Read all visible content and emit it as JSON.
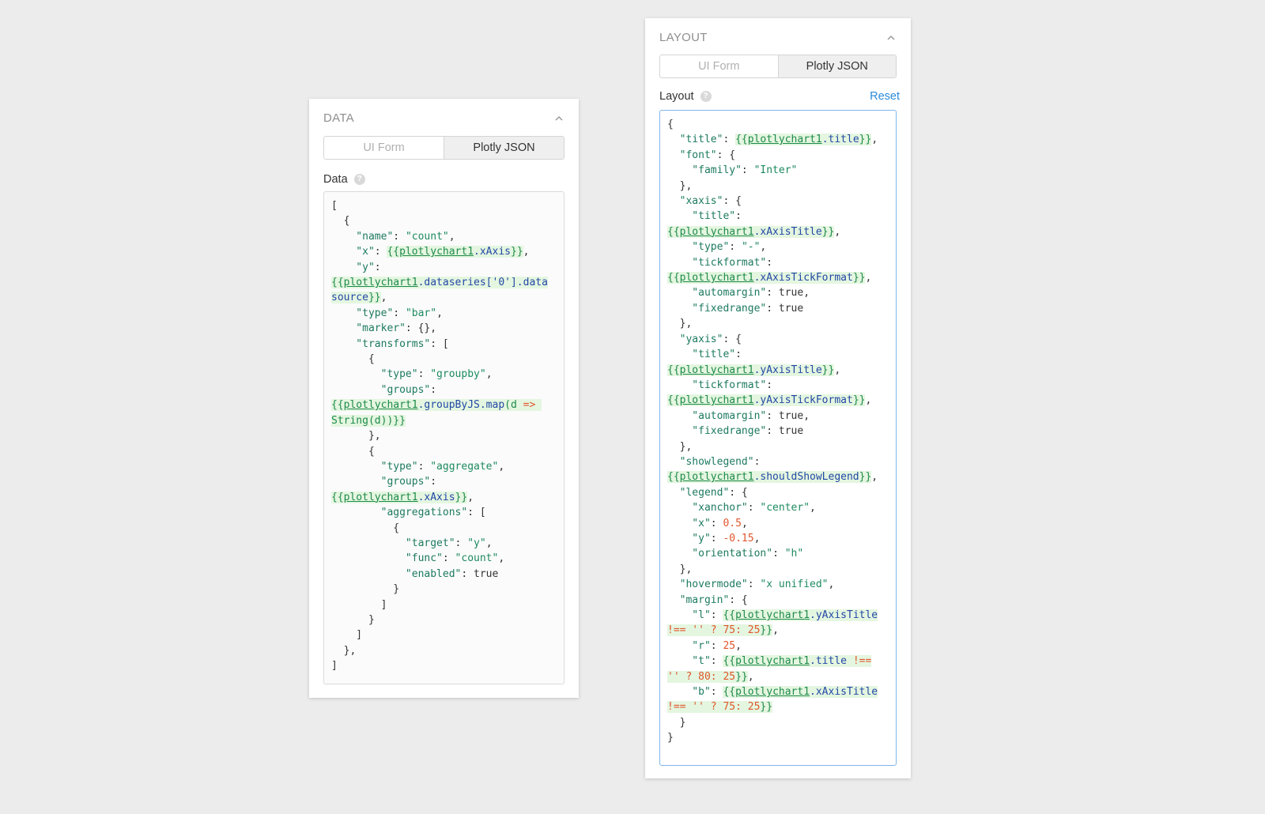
{
  "data_panel": {
    "title": "DATA",
    "tabs": [
      "UI Form",
      "Plotly JSON"
    ],
    "active_tab": "Plotly JSON",
    "field_label": "Data",
    "code_lines": [
      [
        [
          "p",
          "["
        ]
      ],
      [
        [
          "p",
          "  {"
        ]
      ],
      [
        [
          "k",
          "    \"name\""
        ],
        [
          "p",
          ": "
        ],
        [
          "s",
          "\"count\""
        ],
        [
          "p",
          ","
        ]
      ],
      [
        [
          "k",
          "    \"x\""
        ],
        [
          "p",
          ": "
        ],
        [
          "b",
          "{{"
        ],
        [
          "bu",
          "plotlychart1"
        ],
        [
          "bf",
          ".xAxis"
        ],
        [
          "b",
          "}}"
        ],
        [
          "p",
          ","
        ]
      ],
      [
        [
          "k",
          "    \"y\""
        ],
        [
          "p",
          ":"
        ]
      ],
      [
        [
          "b",
          "{{"
        ],
        [
          "bu",
          "plotlychart1"
        ],
        [
          "bf",
          ".dataseries['0'].data"
        ]
      ],
      [
        [
          "bf",
          "source"
        ],
        [
          "b",
          "}}"
        ],
        [
          "p",
          ","
        ]
      ],
      [
        [
          "k",
          "    \"type\""
        ],
        [
          "p",
          ": "
        ],
        [
          "s",
          "\"bar\""
        ],
        [
          "p",
          ","
        ]
      ],
      [
        [
          "k",
          "    \"marker\""
        ],
        [
          "p",
          ": {},"
        ]
      ],
      [
        [
          "k",
          "    \"transforms\""
        ],
        [
          "p",
          ": ["
        ]
      ],
      [
        [
          "p",
          "      {"
        ]
      ],
      [
        [
          "k",
          "        \"type\""
        ],
        [
          "p",
          ": "
        ],
        [
          "s",
          "\"groupby\""
        ],
        [
          "p",
          ","
        ]
      ],
      [
        [
          "k",
          "        \"groups\""
        ],
        [
          "p",
          ":"
        ]
      ],
      [
        [
          "b",
          "{{"
        ],
        [
          "bu",
          "plotlychart1"
        ],
        [
          "bf",
          ".groupByJS.map"
        ],
        [
          "b",
          "(d "
        ],
        [
          "bo",
          "=>"
        ],
        [
          "b",
          " "
        ]
      ],
      [
        [
          "b",
          "String(d))}}"
        ]
      ],
      [
        [
          "p",
          "      },"
        ]
      ],
      [
        [
          "p",
          "      {"
        ]
      ],
      [
        [
          "k",
          "        \"type\""
        ],
        [
          "p",
          ": "
        ],
        [
          "s",
          "\"aggregate\""
        ],
        [
          "p",
          ","
        ]
      ],
      [
        [
          "k",
          "        \"groups\""
        ],
        [
          "p",
          ":"
        ]
      ],
      [
        [
          "b",
          "{{"
        ],
        [
          "bu",
          "plotlychart1"
        ],
        [
          "bf",
          ".xAxis"
        ],
        [
          "b",
          "}}"
        ],
        [
          "p",
          ","
        ]
      ],
      [
        [
          "k",
          "        \"aggregations\""
        ],
        [
          "p",
          ": ["
        ]
      ],
      [
        [
          "p",
          "          {"
        ]
      ],
      [
        [
          "k",
          "            \"target\""
        ],
        [
          "p",
          ": "
        ],
        [
          "s",
          "\"y\""
        ],
        [
          "p",
          ","
        ]
      ],
      [
        [
          "k",
          "            \"func\""
        ],
        [
          "p",
          ": "
        ],
        [
          "s",
          "\"count\""
        ],
        [
          "p",
          ","
        ]
      ],
      [
        [
          "k",
          "            \"enabled\""
        ],
        [
          "p",
          ": true"
        ]
      ],
      [
        [
          "p",
          "          }"
        ]
      ],
      [
        [
          "p",
          "        ]"
        ]
      ],
      [
        [
          "p",
          "      }"
        ]
      ],
      [
        [
          "p",
          "    ]"
        ]
      ],
      [
        [
          "p",
          "  },"
        ]
      ],
      [
        [
          "p",
          "]"
        ]
      ]
    ]
  },
  "layout_panel": {
    "title": "LAYOUT",
    "tabs": [
      "UI Form",
      "Plotly JSON"
    ],
    "active_tab": "Plotly JSON",
    "field_label": "Layout",
    "reset_label": "Reset",
    "code_lines": [
      [
        [
          "p",
          "{"
        ]
      ],
      [
        [
          "k",
          "  \"title\""
        ],
        [
          "p",
          ": "
        ],
        [
          "b",
          "{{"
        ],
        [
          "bu",
          "plotlychart1"
        ],
        [
          "bf",
          ".title"
        ],
        [
          "b",
          "}}"
        ],
        [
          "p",
          ","
        ]
      ],
      [
        [
          "k",
          "  \"font\""
        ],
        [
          "p",
          ": {"
        ]
      ],
      [
        [
          "k",
          "    \"family\""
        ],
        [
          "p",
          ": "
        ],
        [
          "s",
          "\"Inter\""
        ]
      ],
      [
        [
          "p",
          "  },"
        ]
      ],
      [
        [
          "k",
          "  \"xaxis\""
        ],
        [
          "p",
          ": {"
        ]
      ],
      [
        [
          "k",
          "    \"title\""
        ],
        [
          "p",
          ":"
        ]
      ],
      [
        [
          "b",
          "{{"
        ],
        [
          "bu",
          "plotlychart1"
        ],
        [
          "bf",
          ".xAxisTitle"
        ],
        [
          "b",
          "}}"
        ],
        [
          "p",
          ","
        ]
      ],
      [
        [
          "k",
          "    \"type\""
        ],
        [
          "p",
          ": "
        ],
        [
          "s",
          "\"-\""
        ],
        [
          "p",
          ","
        ]
      ],
      [
        [
          "k",
          "    \"tickformat\""
        ],
        [
          "p",
          ":"
        ]
      ],
      [
        [
          "b",
          "{{"
        ],
        [
          "bu",
          "plotlychart1"
        ],
        [
          "bf",
          ".xAxisTickFormat"
        ],
        [
          "b",
          "}}"
        ],
        [
          "p",
          ","
        ]
      ],
      [
        [
          "k",
          "    \"automargin\""
        ],
        [
          "p",
          ": true,"
        ]
      ],
      [
        [
          "k",
          "    \"fixedrange\""
        ],
        [
          "p",
          ": true"
        ]
      ],
      [
        [
          "p",
          "  },"
        ]
      ],
      [
        [
          "k",
          "  \"yaxis\""
        ],
        [
          "p",
          ": {"
        ]
      ],
      [
        [
          "k",
          "    \"title\""
        ],
        [
          "p",
          ":"
        ]
      ],
      [
        [
          "b",
          "{{"
        ],
        [
          "bu",
          "plotlychart1"
        ],
        [
          "bf",
          ".yAxisTitle"
        ],
        [
          "b",
          "}}"
        ],
        [
          "p",
          ","
        ]
      ],
      [
        [
          "k",
          "    \"tickformat\""
        ],
        [
          "p",
          ":"
        ]
      ],
      [
        [
          "b",
          "{{"
        ],
        [
          "bu",
          "plotlychart1"
        ],
        [
          "bf",
          ".yAxisTickFormat"
        ],
        [
          "b",
          "}}"
        ],
        [
          "p",
          ","
        ]
      ],
      [
        [
          "k",
          "    \"automargin\""
        ],
        [
          "p",
          ": true,"
        ]
      ],
      [
        [
          "k",
          "    \"fixedrange\""
        ],
        [
          "p",
          ": true"
        ]
      ],
      [
        [
          "p",
          "  },"
        ]
      ],
      [
        [
          "k",
          "  \"showlegend\""
        ],
        [
          "p",
          ":"
        ]
      ],
      [
        [
          "b",
          "{{"
        ],
        [
          "bu",
          "plotlychart1"
        ],
        [
          "bf",
          ".shouldShowLegend"
        ],
        [
          "b",
          "}}"
        ],
        [
          "p",
          ","
        ]
      ],
      [
        [
          "k",
          "  \"legend\""
        ],
        [
          "p",
          ": {"
        ]
      ],
      [
        [
          "k",
          "    \"xanchor\""
        ],
        [
          "p",
          ": "
        ],
        [
          "s",
          "\"center\""
        ],
        [
          "p",
          ","
        ]
      ],
      [
        [
          "k",
          "    \"x\""
        ],
        [
          "p",
          ": "
        ],
        [
          "n",
          "0.5"
        ],
        [
          "p",
          ","
        ]
      ],
      [
        [
          "k",
          "    \"y\""
        ],
        [
          "p",
          ": "
        ],
        [
          "n",
          "-0.15"
        ],
        [
          "p",
          ","
        ]
      ],
      [
        [
          "k",
          "    \"orientation\""
        ],
        [
          "p",
          ": "
        ],
        [
          "s",
          "\"h\""
        ]
      ],
      [
        [
          "p",
          "  },"
        ]
      ],
      [
        [
          "k",
          "  \"hovermode\""
        ],
        [
          "p",
          ": "
        ],
        [
          "s",
          "\"x unified\""
        ],
        [
          "p",
          ","
        ]
      ],
      [
        [
          "k",
          "  \"margin\""
        ],
        [
          "p",
          ": {"
        ]
      ],
      [
        [
          "k",
          "    \"l\""
        ],
        [
          "p",
          ": "
        ],
        [
          "b",
          "{{"
        ],
        [
          "bu",
          "plotlychart1"
        ],
        [
          "bf",
          ".yAxisTitle"
        ]
      ],
      [
        [
          "bo",
          "!== '' ? 75: 25"
        ],
        [
          "b",
          "}}"
        ],
        [
          "p",
          ","
        ]
      ],
      [
        [
          "k",
          "    \"r\""
        ],
        [
          "p",
          ": "
        ],
        [
          "n",
          "25"
        ],
        [
          "p",
          ","
        ]
      ],
      [
        [
          "k",
          "    \"t\""
        ],
        [
          "p",
          ": "
        ],
        [
          "b",
          "{{"
        ],
        [
          "bu",
          "plotlychart1"
        ],
        [
          "bf",
          ".title"
        ],
        [
          "bo",
          " !=="
        ]
      ],
      [
        [
          "bo",
          "'' ? 80: 25"
        ],
        [
          "b",
          "}}"
        ],
        [
          "p",
          ","
        ]
      ],
      [
        [
          "k",
          "    \"b\""
        ],
        [
          "p",
          ": "
        ],
        [
          "b",
          "{{"
        ],
        [
          "bu",
          "plotlychart1"
        ],
        [
          "bf",
          ".xAxisTitle"
        ]
      ],
      [
        [
          "bo",
          "!== '' ? 75: 25"
        ],
        [
          "b",
          "}}"
        ]
      ],
      [
        [
          "p",
          "  }"
        ]
      ],
      [
        [
          "p",
          "}"
        ]
      ]
    ]
  }
}
